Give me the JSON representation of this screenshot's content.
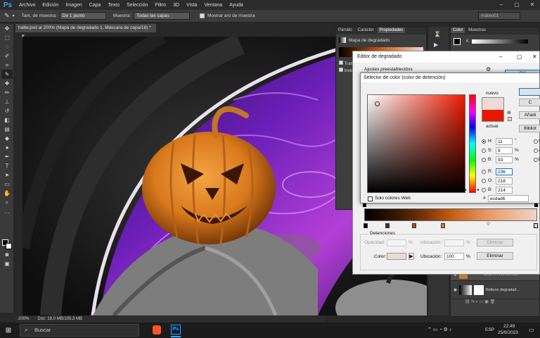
{
  "menu": {
    "items": [
      "Archivo",
      "Edición",
      "Imagen",
      "Capa",
      "Texto",
      "Selección",
      "Filtro",
      "3D",
      "Vista",
      "Ventana",
      "Ayuda"
    ],
    "workspace": "mateo01"
  },
  "options_bar": {
    "sample_size_label": "Tam. de muestra:",
    "sample_size_value": "De 1 punto",
    "sample_label": "Muestra:",
    "sample_value": "Todas las capas",
    "show_ring_label": "Mostrar aro de muestra"
  },
  "document": {
    "tab_title": "hallw.psd al 200% (Mapa de degradado 1, Máscara de capa/16) *",
    "zoom": "200%",
    "doc_size": "Doc: 18,0 MB/105,3 MB"
  },
  "properties_panel": {
    "tabs": [
      "Párrafo",
      "Carácter",
      "Propiedades"
    ],
    "title": "Mapa de degradado",
    "options": [
      "Tram",
      "Inve"
    ],
    "partial": "No"
  },
  "color_panel": {
    "tabs": [
      "Color",
      "Muestras"
    ],
    "k_label": "K"
  },
  "layers": [
    {
      "name": "CAJA INTERNA CLI"
    },
    {
      "name": "Relleno degradad..."
    }
  ],
  "gradient_editor": {
    "title": "Editor de degradado",
    "presets_label": "Ajustes preestablecidos",
    "ok_label": "OK",
    "stops_label": "Detenciones",
    "opacity_label": "Opacidad:",
    "opacity_value": "",
    "opacity_unit": "%",
    "location_label": "Ubicación:",
    "location_unit": "%",
    "delete_label": "Eliminar",
    "color_label": "Color:",
    "color_location_value": "100",
    "color_swatch": "#ecdad6",
    "delete_color_label": "Eliminar"
  },
  "color_picker": {
    "title": "Selector de color (color de detención)",
    "new_label": "nuevo",
    "current_label": "actual",
    "new_color": "#ecdad6",
    "current_color": "#e81800",
    "ok_label": "",
    "cancel_label": "C",
    "add_label": "Añadi",
    "library_label": "Bibliot",
    "h_label": "H:",
    "h_value": "11",
    "h_unit": "°",
    "s_label": "S:",
    "s_value": "9",
    "s_unit": "%",
    "b_label": "B:",
    "b_value": "93",
    "b_unit": "%",
    "r_label": "R:",
    "r_value": "236",
    "g_label": "G:",
    "g_value": "218",
    "bb_label": "B:",
    "bb_value": "214",
    "web_only_label": "Solo colores Web",
    "hex_label": "#",
    "hex_value": "ecdad6",
    "right_labels": [
      "L",
      "a",
      "b"
    ]
  },
  "taskbar": {
    "search_placeholder": "Buscar",
    "time": "22:49",
    "date": "25/9/2023",
    "lang": "ESP"
  }
}
